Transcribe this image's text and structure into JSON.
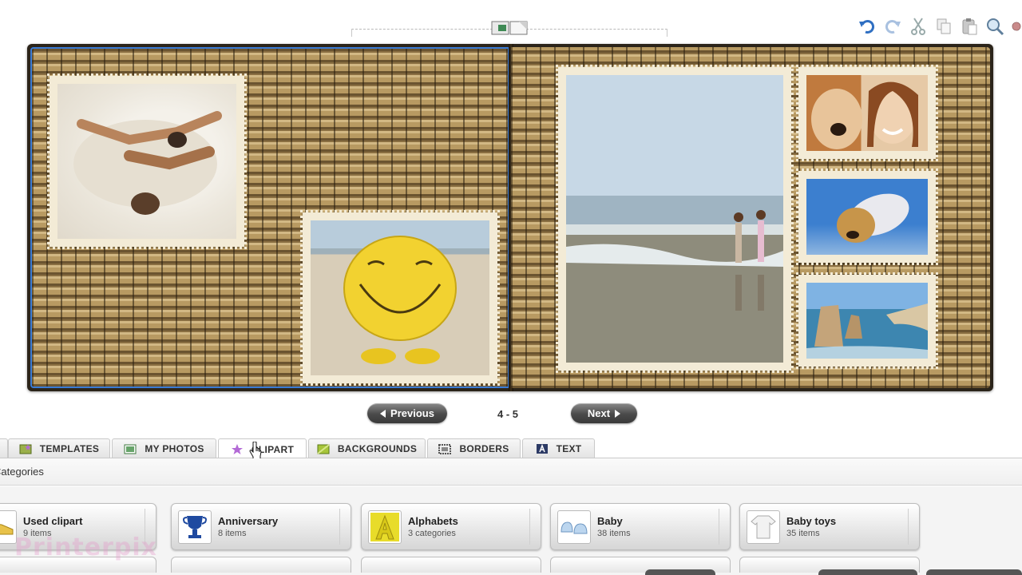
{
  "pager": {
    "previous_label": "Previous",
    "next_label": "Next",
    "page_range": "4 - 5"
  },
  "tabs": [
    {
      "label": "TEMPLATES",
      "icon": "templates-icon"
    },
    {
      "label": "MY PHOTOS",
      "icon": "photos-icon"
    },
    {
      "label": "CLIPART",
      "icon": "star-icon"
    },
    {
      "label": "BACKGROUNDS",
      "icon": "background-icon"
    },
    {
      "label": "BORDERS",
      "icon": "border-icon"
    },
    {
      "label": "TEXT",
      "icon": "text-icon"
    }
  ],
  "active_tab": "CLIPART",
  "categories_header": "Categories",
  "categories": [
    {
      "name": "Used clipart",
      "count": "9 items",
      "icon": "shoe-icon"
    },
    {
      "name": "Anniversary",
      "count": "8 items",
      "icon": "trophy-icon"
    },
    {
      "name": "Alphabets",
      "count": "3 categories",
      "icon": "letter-a-icon"
    },
    {
      "name": "Baby",
      "count": "38 items",
      "icon": "baby-shoes-icon"
    },
    {
      "name": "Baby toys",
      "count": "35 items",
      "icon": "baby-clothes-icon"
    }
  ],
  "watermark": "Printerpix",
  "toolbar_icons": [
    "undo-icon",
    "redo-icon",
    "cut-icon",
    "copy-icon",
    "paste-icon",
    "zoom-icon",
    "settings-icon"
  ],
  "colors": {
    "selection": "#3a7bd5",
    "button_dark": "#4a4a4a",
    "tab_bg": "#e3e3e3"
  }
}
